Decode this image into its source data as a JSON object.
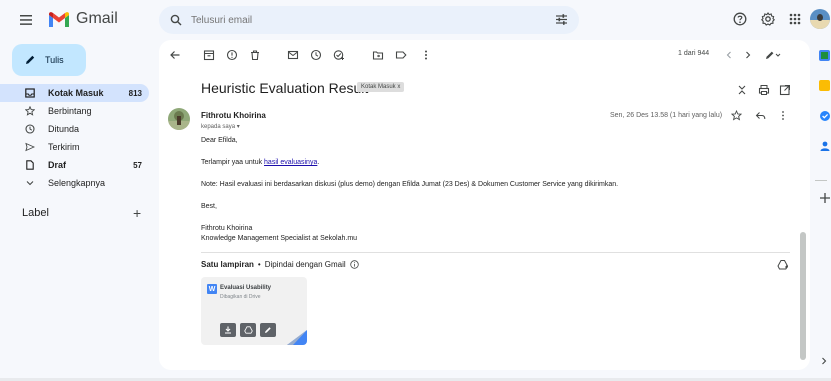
{
  "app": {
    "name": "Gmail"
  },
  "search": {
    "placeholder": "Telusuri email"
  },
  "sidebar": {
    "compose": "Tulis",
    "items": [
      {
        "label": "Kotak Masuk",
        "count": "813"
      },
      {
        "label": "Berbintang",
        "count": ""
      },
      {
        "label": "Ditunda",
        "count": ""
      },
      {
        "label": "Terkirim",
        "count": ""
      },
      {
        "label": "Draf",
        "count": "57"
      },
      {
        "label": "Selengkapnya",
        "count": ""
      }
    ],
    "labels_title": "Label",
    "labels_add": "+"
  },
  "toolbar": {
    "pager": "1 dari 944"
  },
  "email": {
    "subject": "Heuristic Evaluation Result",
    "label_chip": "Kotak Masuk x",
    "sender": "Fithrotu Khoirina",
    "to": "kepada saya ▾",
    "date": "Sen, 26 Des 13.58 (1 hari yang lalu)",
    "greeting": "Dear Efilda,",
    "line1_prefix": "Terlampir yaa untuk ",
    "line1_link": "hasil evaluasinya",
    "line1_suffix": ".",
    "line2": "Note: Hasil evaluasi ini berdasarkan diskusi (plus demo) dengan Efilda Jumat (23 Des) & Dokumen Customer Service yang dikirimkan.",
    "closing": "Best,",
    "sig_name": "Fithrotu Khoirina",
    "sig_title": "Knowledge Management Specialist at Sekolah.mu"
  },
  "attachments": {
    "heading": "Satu lampiran",
    "separator": "•",
    "scanned": "Dipindai dengan Gmail",
    "file_title": "Evaluasi Usability",
    "file_sub": "Dibagikan di Drive",
    "file_badge": "W"
  },
  "colors": {
    "compose_bg": "#c2e7ff",
    "active_nav": "#d3e3fd",
    "link": "#1a0dab",
    "gmail_red": "#ea4335",
    "gmail_blue": "#4285f4"
  }
}
